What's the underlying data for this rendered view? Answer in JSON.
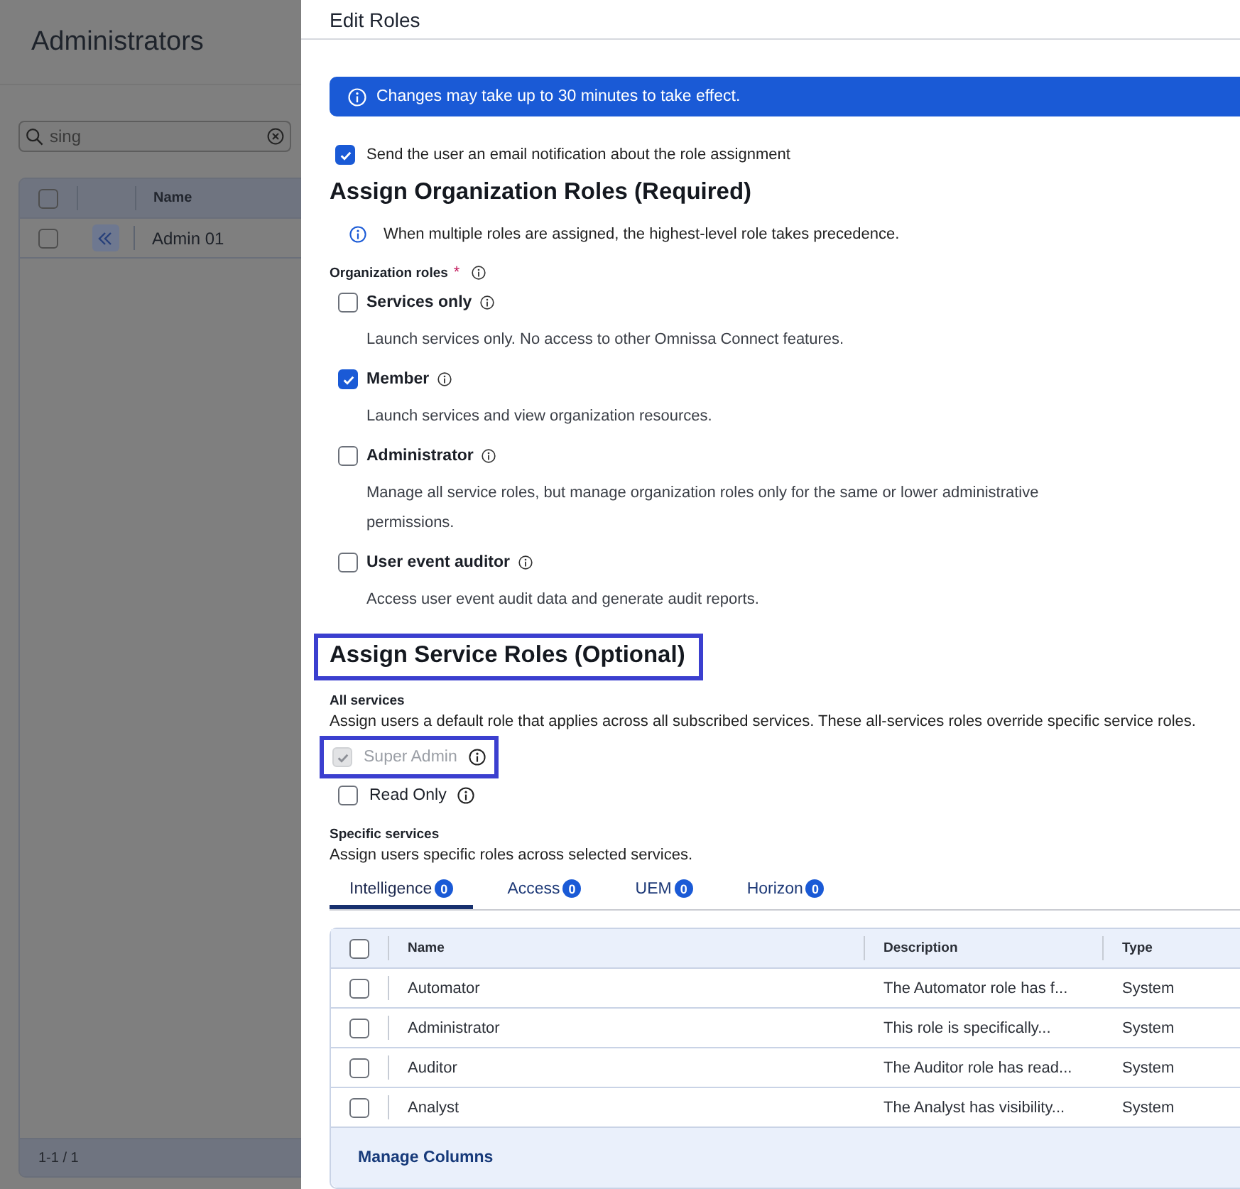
{
  "background_page": {
    "title": "Administrators",
    "search": {
      "value": "sing"
    },
    "table": {
      "header_checked": false,
      "columns": [
        "Name"
      ],
      "rows": [
        {
          "name": "Admin 01",
          "checked": false
        }
      ],
      "pagination": "1-1 / 1"
    }
  },
  "panel": {
    "title": "Edit Roles",
    "banner": "Changes may take up to 30 minutes to take effect.",
    "notify": {
      "label": "Send the user an email notification about the role assignment",
      "checked": true
    },
    "org_section": {
      "heading": "Assign Organization Roles (Required)",
      "highlighted": false,
      "note": "When multiple roles are assigned, the highest-level role takes precedence.",
      "field_label": "Organization roles",
      "required_mark": "*",
      "options": [
        {
          "label": "Services only",
          "description": "Launch services only. No access to other Omnissa Connect features.",
          "checked": false
        },
        {
          "label": "Member",
          "description": "Launch services and view organization resources.",
          "checked": true
        },
        {
          "label": "Administrator",
          "description": "Manage all service roles, but manage organization roles only for the same or lower administrative permissions.",
          "checked": false
        },
        {
          "label": "User event auditor",
          "description": "Access user event audit data and generate audit reports.",
          "checked": false
        }
      ]
    },
    "service_section": {
      "heading": "Assign Service Roles (Optional)",
      "highlighted": true,
      "all_services": {
        "label": "All services",
        "description": "Assign users a default role that applies across all subscribed services. These all-services roles override specific service roles.",
        "options": [
          {
            "label": "Super Admin",
            "checked": true,
            "disabled": true,
            "highlighted": true
          },
          {
            "label": "Read Only",
            "checked": false,
            "disabled": false,
            "highlighted": false
          }
        ]
      },
      "specific_services": {
        "label": "Specific services",
        "description": "Assign users specific roles across selected services.",
        "tabs": [
          {
            "label": "Intelligence",
            "count": "0",
            "selected": true
          },
          {
            "label": "Access",
            "count": "0",
            "selected": false
          },
          {
            "label": "UEM",
            "count": "0",
            "selected": false
          },
          {
            "label": "Horizon",
            "count": "0",
            "selected": false
          }
        ],
        "table": {
          "header_checked": false,
          "columns": [
            "Name",
            "Description",
            "Type"
          ],
          "rows": [
            {
              "cells": [
                "Automator",
                "The Automator role has f...",
                "System"
              ],
              "checked": false
            },
            {
              "cells": [
                "Administrator",
                "This role is specifically...",
                "System"
              ],
              "checked": false
            },
            {
              "cells": [
                "Auditor",
                "The Auditor role has read...",
                "System"
              ],
              "checked": false
            },
            {
              "cells": [
                "Analyst",
                "The Analyst has visibility...",
                "System"
              ],
              "checked": false
            }
          ],
          "footer_link": "Manage Columns"
        }
      }
    }
  }
}
